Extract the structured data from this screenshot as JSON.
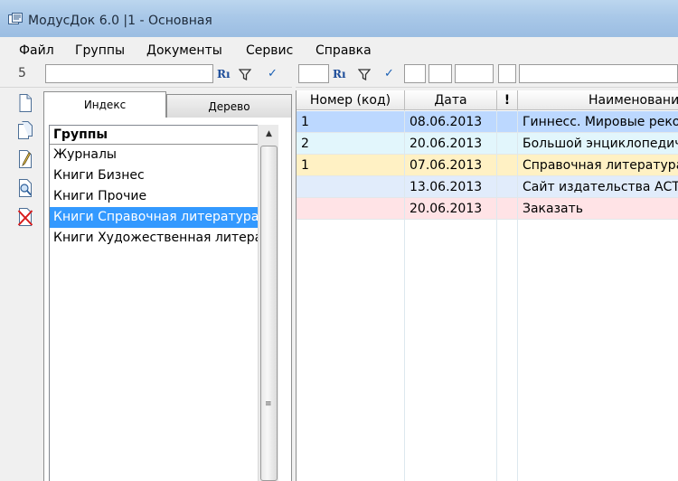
{
  "window": {
    "title": "МодусДок 6.0 |1 - Основная"
  },
  "menu": [
    "Файл",
    "Группы",
    "Документы",
    "Сервис",
    "Справка"
  ],
  "filter_bar": {
    "counter": "5"
  },
  "tabs": [
    {
      "label": "Индекс",
      "active": true
    },
    {
      "label": "Дерево",
      "active": false
    }
  ],
  "groups": {
    "header": "Группы",
    "items": [
      "Журналы",
      "Книги Бизнес",
      "Книги Прочие",
      "Книги Справочная литература",
      "Книги Художественная литература"
    ],
    "selected": "Книги Справочная литература"
  },
  "documents": {
    "columns": [
      "Номер (код)",
      "Дата",
      "!",
      "Наименование"
    ],
    "rows": [
      {
        "number": "1",
        "date": "08.06.2013",
        "flag": "",
        "name": "Гиннесс. Мировые рекорды",
        "color": "#bcd8ff"
      },
      {
        "number": "2",
        "date": "20.06.2013",
        "flag": "",
        "name": "Большой энциклопедический словарь",
        "color": "#e2f6fc"
      },
      {
        "number": "1",
        "date": "07.06.2013",
        "flag": "",
        "name": "Справочная литература",
        "color": "#fff1c4"
      },
      {
        "number": "",
        "date": "13.06.2013",
        "flag": "",
        "name": "Сайт издательства АСТ",
        "color": "#e1ecfb"
      },
      {
        "number": "",
        "date": "20.06.2013",
        "flag": "",
        "name": "Заказать",
        "color": "#ffe3e6"
      }
    ]
  },
  "icons": [
    "app-icon",
    "new-document-icon",
    "copy-document-icon",
    "edit-document-icon",
    "view-document-icon",
    "delete-document-icon",
    "sort-icon",
    "filter-icon",
    "check-icon"
  ],
  "colors": {
    "selection": "#3399ff",
    "titlebar": "#a9c8e8"
  }
}
